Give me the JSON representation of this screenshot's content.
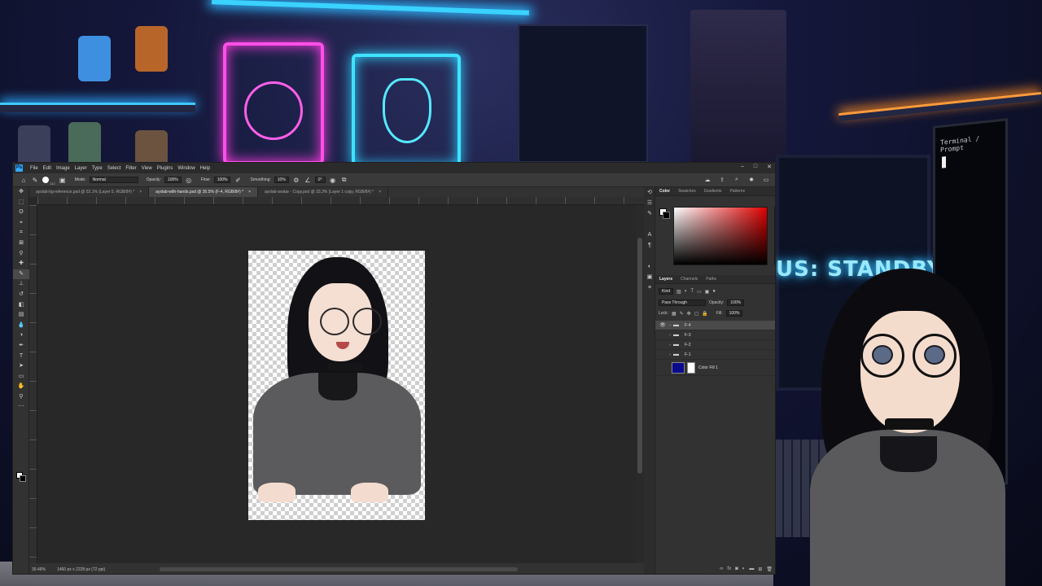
{
  "scene": {
    "standby_text": "US: STANDBY",
    "terminal_title": "Terminal / Prompt",
    "accent_colors": {
      "cyan": "#3fe2ff",
      "pink": "#ff4fe8",
      "orange": "#ff9b3a"
    }
  },
  "photoshop": {
    "menu": [
      "File",
      "Edit",
      "Image",
      "Layer",
      "Type",
      "Select",
      "Filter",
      "View",
      "Plugins",
      "Window",
      "Help"
    ],
    "window_controls": [
      "–",
      "□",
      "✕"
    ],
    "options": {
      "brush_size": "142",
      "mode_label": "Mode:",
      "mode_value": "Normal",
      "opacity_label": "Opacity:",
      "opacity_value": "100%",
      "flow_label": "Flow:",
      "flow_value": "100%",
      "smoothing_label": "Smoothing:",
      "smoothing_value": "10%",
      "angle_value": "0°"
    },
    "tabs": [
      {
        "label": "ayslab-bg-reference.psd @ 52.1% (Layer 5, RGB/8#) *",
        "close": "×"
      },
      {
        "label": "ayslab-with-hands.psd @ 30.5% (F-4, RGB/8#) *",
        "close": "×"
      },
      {
        "label": "ayslab-avatar - Copy.psd @ 33.3% (Layer 1 copy, RGB/8#) *",
        "close": "×"
      }
    ],
    "status": {
      "zoom": "30.46%",
      "doc_size": "1460 px x 2228 px (72 ppi)"
    },
    "color_panel": {
      "tabs": [
        "Color",
        "Swatches",
        "Gradients",
        "Patterns"
      ],
      "foreground": "#ffffff",
      "background": "#000000"
    },
    "layers_panel": {
      "tabs": [
        "Layers",
        "Channels",
        "Paths"
      ],
      "filter_value": "Kind",
      "blend_mode": "Pass Through",
      "opacity_label": "Opacity:",
      "opacity_value": "100%",
      "lock_label": "Lock:",
      "fill_label": "Fill:",
      "fill_value": "100%",
      "layers": [
        {
          "name": "F-4",
          "visible": true,
          "selected": true
        },
        {
          "name": "F-3",
          "visible": false,
          "selected": false
        },
        {
          "name": "F-2",
          "visible": false,
          "selected": false
        },
        {
          "name": "F-1",
          "visible": false,
          "selected": false
        },
        {
          "name": "Color Fill 1",
          "visible": false,
          "selected": false,
          "fill_color": "#0a0a8c"
        }
      ]
    }
  }
}
